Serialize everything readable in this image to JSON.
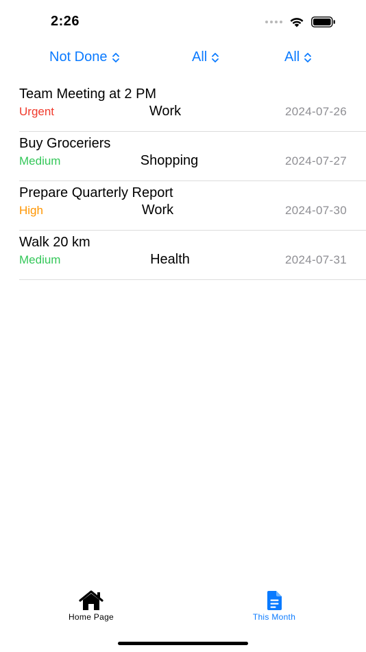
{
  "status_bar": {
    "time": "2:26"
  },
  "filters": {
    "status": "Not Done",
    "priority": "All",
    "category": "All",
    "accent_color": "#0a7aff"
  },
  "tasks": [
    {
      "title": "Team Meeting at 2 PM",
      "priority": "Urgent",
      "priority_color": "#f0392b",
      "category": "Work",
      "date": "2024-07-26"
    },
    {
      "title": "Buy Groceriers",
      "priority": "Medium",
      "priority_color": "#34c759",
      "category": "Shopping",
      "date": "2024-07-27"
    },
    {
      "title": "Prepare Quarterly Report",
      "priority": "High",
      "priority_color": "#ff9500",
      "category": "Work",
      "date": "2024-07-30"
    },
    {
      "title": "Walk 20 km",
      "priority": "Medium",
      "priority_color": "#34c759",
      "category": "Health",
      "date": "2024-07-31"
    }
  ],
  "tabbar": {
    "home": {
      "label": "Home Page",
      "icon": "house-icon",
      "color": "#000000"
    },
    "this_month": {
      "label": "This Month",
      "icon": "document-icon",
      "color": "#0a7aff",
      "selected": true
    }
  }
}
